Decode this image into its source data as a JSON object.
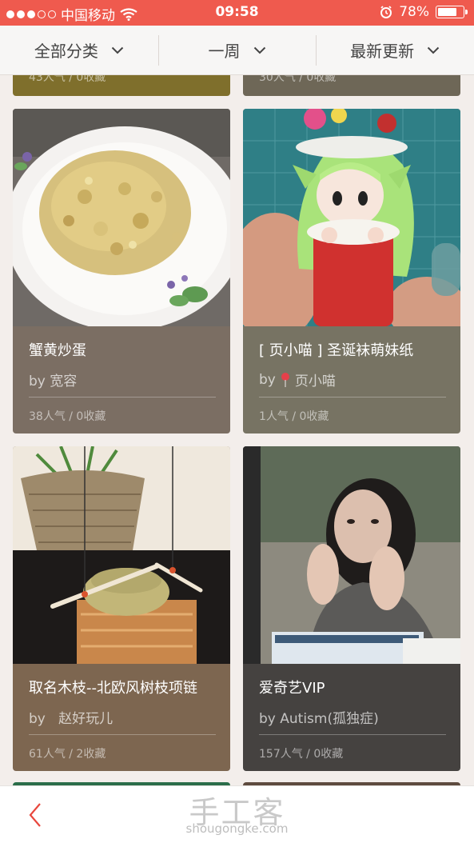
{
  "status_bar": {
    "carrier": "中国移动",
    "time": "09:58",
    "battery": "78%",
    "battery_level": 0.78,
    "icons": [
      "signal-dots",
      "wifi-icon",
      "alarm-icon",
      "battery-icon"
    ]
  },
  "filters": [
    {
      "label": "全部分类",
      "icon": "chevron-down-icon"
    },
    {
      "label": "一周",
      "icon": "chevron-down-icon"
    },
    {
      "label": "最新更新",
      "icon": "chevron-down-icon"
    }
  ],
  "peek_cards": [
    {
      "stats": "43人气 / 0收藏",
      "color": "#7f6f2c"
    },
    {
      "stats": "30人气 / 0收藏",
      "color": "#6e6757"
    }
  ],
  "cards": [
    {
      "title": "蟹黄炒蛋",
      "author": "by 宽容",
      "stats": "38人气 / 0收藏",
      "color": "#7b6e63"
    },
    {
      "title": "[ 页小喵 ] 圣诞袜萌妹纸",
      "author_prefix": "by",
      "author_name": "页小喵",
      "author_icon": "pin-icon",
      "stats": "1人气 / 0收藏",
      "color": "#777363"
    },
    {
      "title": "取名木枝--北欧风树枝项链",
      "author": "by   赵好玩儿",
      "stats": "61人气 / 2收藏",
      "color": "#7d6650"
    },
    {
      "title": "爱奇艺VIP",
      "author": "by Autism(孤独症)",
      "stats": "157人气 / 0收藏",
      "color": "#454240"
    }
  ],
  "bottom_bar": {
    "back_icon": "chevron-left-icon",
    "watermark_logo": "手工客",
    "watermark_url": "shougongke.com",
    "accent": "#e8473d"
  },
  "colors": {
    "status_bar": "#ef5a4e",
    "background": "#f3eeeb"
  }
}
